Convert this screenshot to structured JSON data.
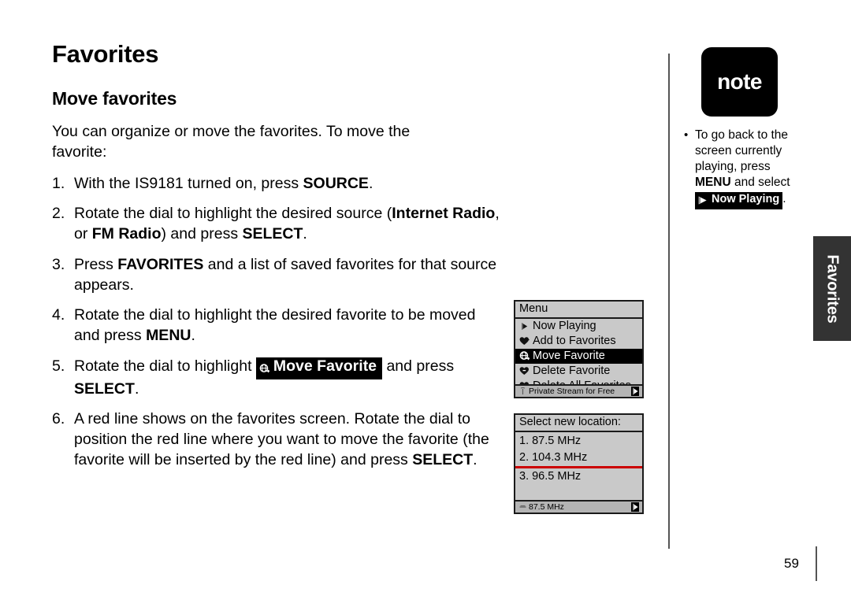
{
  "page": {
    "title": "Favorites",
    "section_title": "Move favorites",
    "intro": "You can organize or move the favorites. To move the favorite:",
    "page_number": "59",
    "side_tab_label": "Favorites"
  },
  "steps": [
    {
      "num": "1.",
      "parts": [
        {
          "t": "With the IS9181 turned on, press ",
          "bold": false
        },
        {
          "t": "SOURCE",
          "bold": true
        },
        {
          "t": ".",
          "bold": false
        }
      ]
    },
    {
      "num": "2.",
      "parts": [
        {
          "t": "Rotate the dial to highlight the desired source (",
          "bold": false
        },
        {
          "t": "Internet Radio",
          "bold": true
        },
        {
          "t": ", or ",
          "bold": false
        },
        {
          "t": "FM Radio",
          "bold": true
        },
        {
          "t": ") and press ",
          "bold": false
        },
        {
          "t": "SELECT",
          "bold": true
        },
        {
          "t": ".",
          "bold": false
        }
      ]
    },
    {
      "num": "3.",
      "parts": [
        {
          "t": "Press ",
          "bold": false
        },
        {
          "t": "FAVORITES",
          "bold": true
        },
        {
          "t": " and a list of saved favorites for that source appears.",
          "bold": false
        }
      ]
    },
    {
      "num": "4.",
      "parts": [
        {
          "t": "Rotate the dial to highlight the desired favorite to be moved and press ",
          "bold": false
        },
        {
          "t": "MENU",
          "bold": true
        },
        {
          "t": ".",
          "bold": false
        }
      ]
    },
    {
      "num": "5.",
      "parts": [
        {
          "t": "Rotate the dial to highlight ",
          "bold": false
        },
        {
          "t": "BADGE:move-favorite",
          "badge": true,
          "badge_label": "Move Favorite",
          "badge_icon": "move-favorite-icon"
        },
        {
          "t": " and press ",
          "bold": false
        },
        {
          "t": "SELECT",
          "bold": true
        },
        {
          "t": ".",
          "bold": false
        }
      ]
    },
    {
      "num": "6.",
      "parts": [
        {
          "t": "A red line shows on the favorites screen. Rotate the dial to position the red line where you want to move the favorite (the favorite will be inserted by the red line) and press ",
          "bold": false
        },
        {
          "t": "SELECT",
          "bold": true
        },
        {
          "t": ".",
          "bold": false
        }
      ]
    }
  ],
  "note": {
    "badge_label": "note",
    "bullet_marker": "•",
    "text_before": "To go back to the screen currently playing, press ",
    "menu_word": "MENU",
    "text_middle": " and select ",
    "now_playing_label": "Now Playing",
    "now_playing_icon": "play-icon",
    "text_after": "."
  },
  "lcd_menu": {
    "title": "Menu",
    "items": [
      {
        "label": "Now Playing",
        "icon": "play-icon",
        "selected": false
      },
      {
        "label": "Add to Favorites",
        "icon": "heart-add-icon",
        "selected": false
      },
      {
        "label": "Move Favorite",
        "icon": "move-favorite-icon",
        "selected": true
      },
      {
        "label": "Delete Favorite",
        "icon": "heart-delete-icon",
        "selected": false
      },
      {
        "label": "Delete All Favorites",
        "icon": "heart-delete-all-icon",
        "selected": false
      }
    ],
    "status_text": "Private Stream for Free",
    "status_icon": "antenna-icon",
    "status_arrow_icon": "play-arrow-icon"
  },
  "lcd_location": {
    "title": "Select new location:",
    "items_before_line": [
      "1. 87.5 MHz",
      "2. 104.3 MHz"
    ],
    "items_after_line": [
      "3. 96.5 MHz"
    ],
    "insert_line_color": "#cc0000",
    "status_text": "87.5 MHz",
    "status_icon": "fm-icon",
    "status_arrow_icon": "play-arrow-icon"
  }
}
